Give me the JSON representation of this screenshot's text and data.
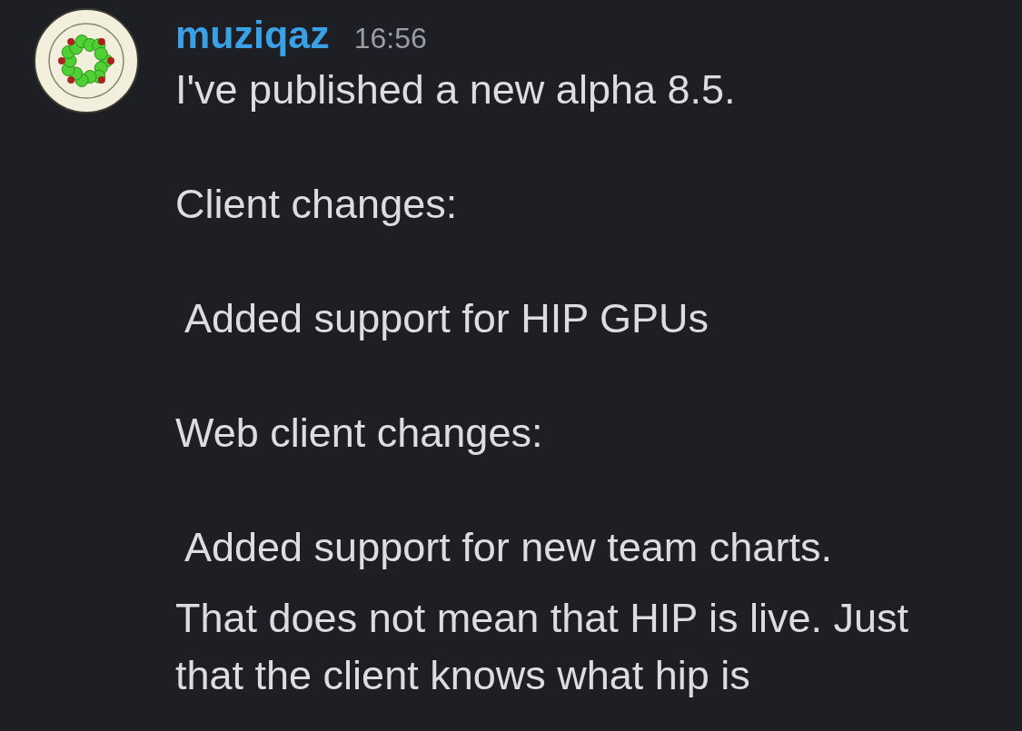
{
  "message_group": {
    "author": "muziqaz",
    "timestamp": "16:56",
    "messages": [
      {
        "paragraphs": [
          {
            "text": "I've published a new alpha 8.5.",
            "indented": false
          },
          {
            "text": "Client changes:",
            "indented": false
          },
          {
            "text": "Added support for HIP GPUs",
            "indented": true
          },
          {
            "text": "Web client changes:",
            "indented": false
          },
          {
            "text": "Added support for new team charts.",
            "indented": true
          }
        ]
      },
      {
        "paragraphs": [
          {
            "text": "That does not mean that HIP is live. Just that the client knows what hip is",
            "indented": false
          }
        ]
      }
    ]
  }
}
